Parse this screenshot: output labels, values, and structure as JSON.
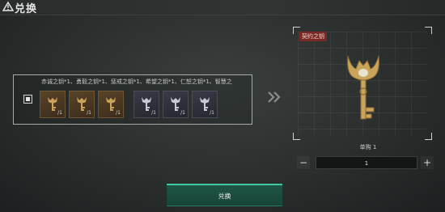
{
  "header": {
    "title": "兑换",
    "warn_icon": "warning-triangle-icon"
  },
  "left_panel": {
    "description": "赤诚之钥*1、勇毅之钥*1、惩戒之钥*1、希望之钥*1、仁恕之钥*1、智慧之",
    "slots": [
      {
        "type": "gold",
        "count": "/1",
        "icon": "gold-key-icon"
      },
      {
        "type": "gold",
        "count": "/1",
        "icon": "gold-key-icon"
      },
      {
        "type": "gold",
        "count": "/1",
        "icon": "gold-key-icon"
      },
      {
        "type": "silver",
        "count": "/1",
        "icon": "silver-key-icon"
      },
      {
        "type": "silver",
        "count": "/1",
        "icon": "silver-key-icon"
      },
      {
        "type": "silver",
        "count": "/1",
        "icon": "silver-key-icon"
      }
    ]
  },
  "preview": {
    "item_name": "契约之钥"
  },
  "quantity": {
    "label": "单购 1",
    "minus": "−",
    "plus": "+",
    "value": "1"
  },
  "confirm_label": "兑换",
  "colors": {
    "accent": "#3fc9a2",
    "tag": "#7a2a26",
    "gold_key": "#c9a45a"
  }
}
